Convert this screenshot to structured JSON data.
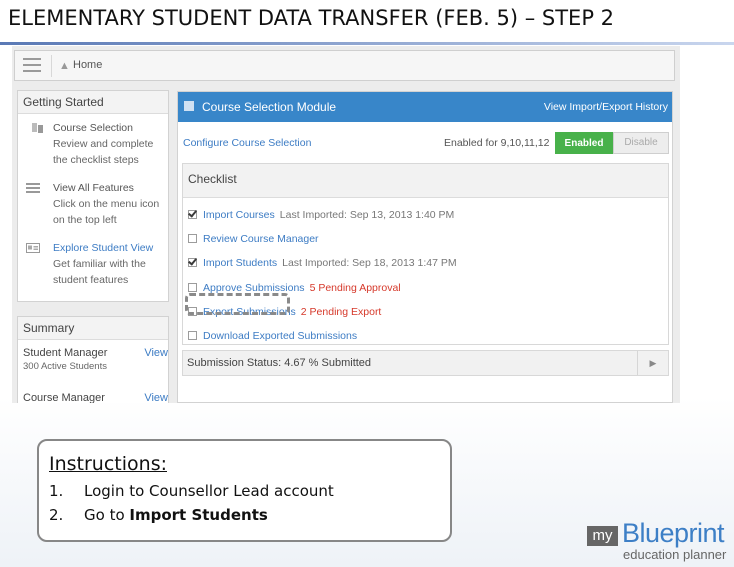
{
  "slide": {
    "title": "ELEMENTARY STUDENT DATA TRANSFER (FEB. 5) – STEP 2"
  },
  "app": {
    "breadcrumb": {
      "home_label": "Home"
    },
    "getting_started": {
      "title": "Getting Started",
      "items": [
        {
          "title": "Course Selection",
          "desc": "Review and complete the checklist steps",
          "icon": "book-icon"
        },
        {
          "title": "View All Features",
          "desc": "Click on the menu icon on the top left",
          "icon": "menu-icon"
        },
        {
          "title": "Explore Student View",
          "desc": "Get familiar with the student features",
          "icon": "id-card-icon"
        }
      ]
    },
    "summary": {
      "title": "Summary",
      "rows": [
        {
          "name": "Student Manager",
          "view": "View",
          "sub": "300 Active Students"
        },
        {
          "name": "Course Manager",
          "view": "View"
        }
      ]
    },
    "module": {
      "title": "Course Selection Module",
      "history_link": "View Import/Export History",
      "configure_link": "Configure Course Selection",
      "enabled_for": "Enabled for 9,10,11,12",
      "enabled_label": "Enabled",
      "disable_label": "Disable",
      "checklist_title": "Checklist",
      "checklist": [
        {
          "label": "Import Courses",
          "meta": "Last Imported: Sep 13, 2013 1:40 PM",
          "warn": "",
          "checked": true
        },
        {
          "label": "Review Course Manager",
          "meta": "",
          "warn": "",
          "checked": false
        },
        {
          "label": "Import Students",
          "meta": "Last Imported: Sep 18, 2013 1:47 PM",
          "warn": "",
          "checked": true
        },
        {
          "label": "Approve Submissions",
          "meta": "",
          "warn": "5 Pending Approval",
          "checked": false
        },
        {
          "label": "Export Submissions",
          "meta": "",
          "warn": "2 Pending Export",
          "checked": false
        },
        {
          "label": "Download Exported Submissions",
          "meta": "",
          "warn": "",
          "checked": false
        }
      ],
      "status": "Submission Status: 4.67 % Submitted"
    }
  },
  "instructions": {
    "title": "Instructions:",
    "steps": [
      {
        "num": "1.",
        "text": "Login to Counsellor Lead account",
        "bold": ""
      },
      {
        "num": "2.",
        "text": "Go to ",
        "bold": "Import Students"
      }
    ]
  },
  "logo": {
    "my": "my",
    "brand": "Blueprint",
    "tagline": "education planner"
  },
  "colors": {
    "brand_blue": "#3886c9",
    "enabled_green": "#48b14a",
    "warning_red": "#d6392b",
    "link_blue": "#3d7cc4"
  }
}
